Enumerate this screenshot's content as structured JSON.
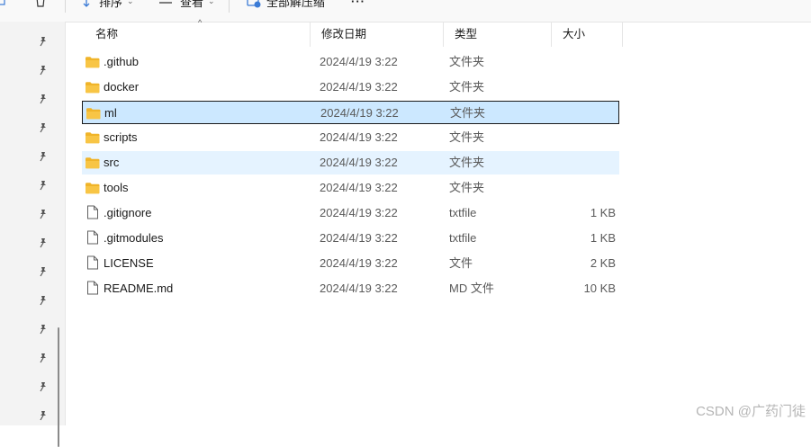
{
  "toolbar": {
    "sort_label": "排序",
    "view_label": "查看",
    "extract_label": "全部解压缩",
    "more_label": "···"
  },
  "columns": {
    "name": "名称",
    "date": "修改日期",
    "type": "类型",
    "size": "大小"
  },
  "files": [
    {
      "name": ".github",
      "date": "2024/4/19 3:22",
      "type": "文件夹",
      "size": "",
      "icon": "folder-icon"
    },
    {
      "name": "docker",
      "date": "2024/4/19 3:22",
      "type": "文件夹",
      "size": "",
      "icon": "folder-icon"
    },
    {
      "name": "ml",
      "date": "2024/4/19 3:22",
      "type": "文件夹",
      "size": "",
      "icon": "folder-icon"
    },
    {
      "name": "scripts",
      "date": "2024/4/19 3:22",
      "type": "文件夹",
      "size": "",
      "icon": "folder-icon"
    },
    {
      "name": "src",
      "date": "2024/4/19 3:22",
      "type": "文件夹",
      "size": "",
      "icon": "folder-icon"
    },
    {
      "name": "tools",
      "date": "2024/4/19 3:22",
      "type": "文件夹",
      "size": "",
      "icon": "folder-icon"
    },
    {
      "name": ".gitignore",
      "date": "2024/4/19 3:22",
      "type": "txtfile",
      "size": "1 KB",
      "icon": "file-icon"
    },
    {
      "name": ".gitmodules",
      "date": "2024/4/19 3:22",
      "type": "txtfile",
      "size": "1 KB",
      "icon": "file-icon"
    },
    {
      "name": "LICENSE",
      "date": "2024/4/19 3:22",
      "type": "文件",
      "size": "2 KB",
      "icon": "file-icon"
    },
    {
      "name": "README.md",
      "date": "2024/4/19 3:22",
      "type": "MD 文件",
      "size": "10 KB",
      "icon": "file-icon"
    }
  ],
  "watermark": "CSDN @广药门徒",
  "colors": {
    "selected_bg": "#cce8ff",
    "hover_bg": "#e5f3ff",
    "folder_yellow": "#f8c545"
  }
}
